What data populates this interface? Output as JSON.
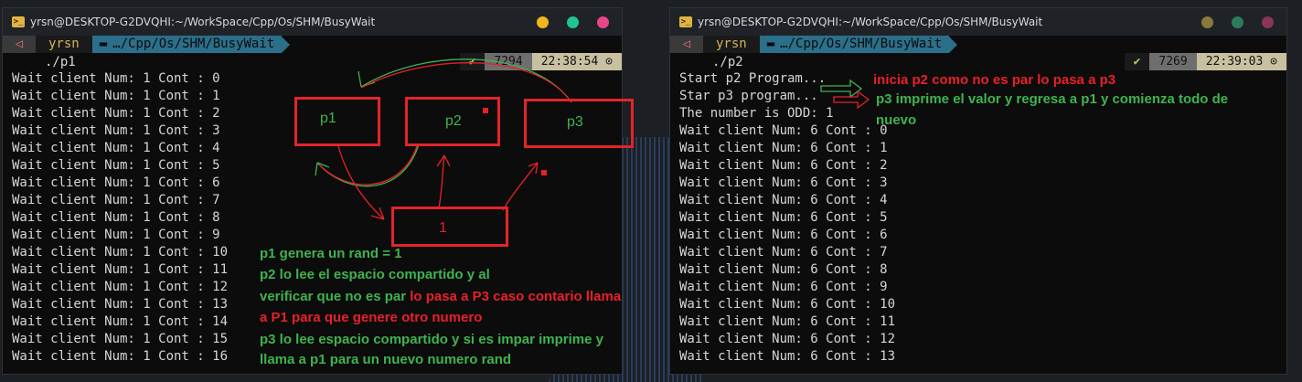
{
  "colors": {
    "annotation_green": "#3fb34f",
    "annotation_red": "#e8202a",
    "box": "#e3242b",
    "path_segment": "#2b6f8a"
  },
  "terminal1": {
    "title": "yrsn@DESKTOP-G2DVQHI:~/WorkSpace/Cpp/Os/SHM/BusyWait",
    "prompt": {
      "os_icon": "◁",
      "user": "yrsn",
      "path": "…/Cpp/Os/SHM/BusyWait"
    },
    "command": "./p1",
    "status": {
      "ok": "✔",
      "pid": "7294",
      "time": "22:38:54 ⊙"
    },
    "lines": [
      "Wait client Num: 1 Cont : 0",
      "Wait client Num: 1 Cont : 1",
      "Wait client Num: 1 Cont : 2",
      "Wait client Num: 1 Cont : 3",
      "Wait client Num: 1 Cont : 4",
      "Wait client Num: 1 Cont : 5",
      "Wait client Num: 1 Cont : 6",
      "Wait client Num: 1 Cont : 7",
      "Wait client Num: 1 Cont : 8",
      "Wait client Num: 1 Cont : 9",
      "Wait client Num: 1 Cont : 10",
      "Wait client Num: 1 Cont : 11",
      "Wait client Num: 1 Cont : 12",
      "Wait client Num: 1 Cont : 13",
      "Wait client Num: 1 Cont : 14",
      "Wait client Num: 1 Cont : 15",
      "Wait client Num: 1 Cont : 16"
    ]
  },
  "terminal2": {
    "title": "yrsn@DESKTOP-G2DVQHI:~/WorkSpace/Cpp/Os/SHM/BusyWait",
    "prompt": {
      "os_icon": "◁",
      "user": "yrsn",
      "path": "…/Cpp/Os/SHM/BusyWait"
    },
    "command": "./p2",
    "status": {
      "ok": "✔",
      "pid": "7269",
      "time": "22:39:03 ⊙"
    },
    "lines": [
      "Start p2 Program...",
      "Star p3 program...",
      "The number is ODD: 1",
      "Wait client Num: 6 Cont : 0",
      "Wait client Num: 6 Cont : 1",
      "Wait client Num: 6 Cont : 2",
      "Wait client Num: 6 Cont : 3",
      "Wait client Num: 6 Cont : 4",
      "Wait client Num: 6 Cont : 5",
      "Wait client Num: 6 Cont : 6",
      "Wait client Num: 6 Cont : 7",
      "Wait client Num: 6 Cont : 8",
      "Wait client Num: 6 Cont : 9",
      "Wait client Num: 6 Cont : 10",
      "Wait client Num: 6 Cont : 11",
      "Wait client Num: 6 Cont : 12",
      "Wait client Num: 6 Cont : 13"
    ]
  },
  "diagram": {
    "p1": "p1",
    "p2": "p2",
    "p3": "p3",
    "value": "1"
  },
  "notes_left": [
    {
      "text": "p1 genera un rand = 1",
      "color": "green"
    },
    {
      "text": "p2 lo lee  el espacio compartido y al",
      "color": "green"
    },
    {
      "text": "verificar que no es par ",
      "color": "green",
      "text2": "lo pasa a P3 caso contario llama"
    },
    {
      "text": "a P1 para que genere otro numero",
      "color": "red"
    },
    {
      "text": "p3 lo lee espacio compartido y si es impar imprime y",
      "color": "green"
    },
    {
      "text": "llama a p1 para un nuevo numero rand",
      "color": "green"
    }
  ],
  "notes_right": {
    "line1": "inicia p2 como no es par lo pasa a p3",
    "line2": "p3 imprime el valor y regresa a p1 y comienza todo de",
    "line3": "nuevo"
  }
}
